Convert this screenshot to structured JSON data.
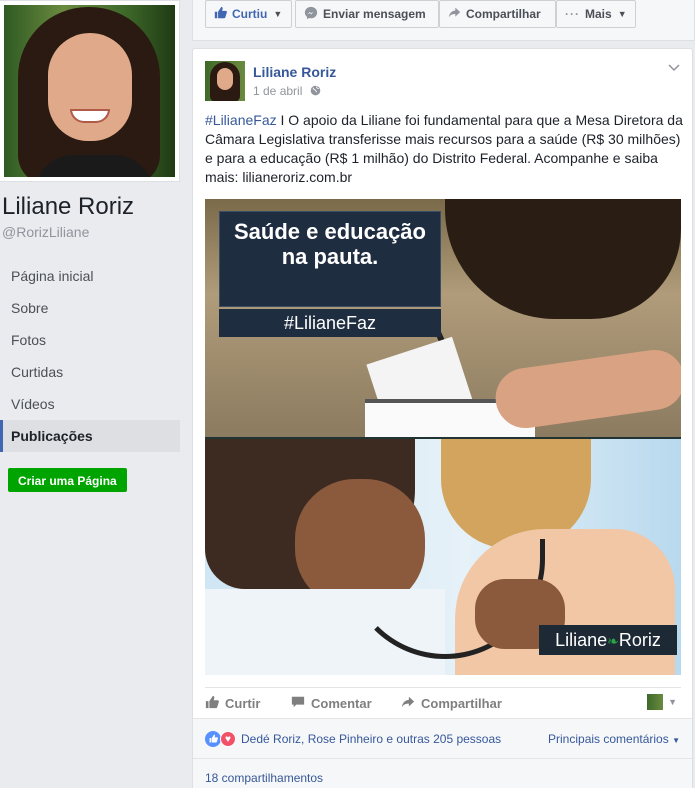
{
  "profile": {
    "name": "Liliane Roriz",
    "handle": "@RorizLiliane"
  },
  "nav": {
    "items": [
      "Página inicial",
      "Sobre",
      "Fotos",
      "Curtidas",
      "Vídeos",
      "Publicações"
    ],
    "active": "Publicações",
    "create_page": "Criar uma Página"
  },
  "actionbar": {
    "like": "Curtiu",
    "message": "Enviar mensagem",
    "share": "Compartilhar",
    "more": "Mais"
  },
  "post": {
    "author": "Liliane Roriz",
    "date": "1 de abril",
    "privacy_icon": "globe-icon",
    "hashtag": "#LilianeFaz",
    "text": " I O apoio da Liliane foi fundamental para que a Mesa Diretora da Câmara Legislativa transferisse mais recursos para a saúde (R$ 30 milhões) e para a educação (R$ 1 milhão) do Distrito Federal. Acompanhe e saiba mais: lilianeroriz.com.br",
    "image": {
      "headline_line1": "Saúde e educação",
      "headline_line2": "na pauta.",
      "headline_tag": "#LilianeFaz",
      "brand_left": "Liliane",
      "brand_right": "Roriz"
    },
    "actions": {
      "like": "Curtir",
      "comment": "Comentar",
      "share": "Compartilhar"
    },
    "reactions_text": "Dedé Roriz, Rose Pinheiro e outras 205 pessoas",
    "sort_label": "Principais comentários",
    "shares": "18 compartilhamentos"
  },
  "colors": {
    "link": "#365899",
    "create_page_bg": "#00a400",
    "like_reaction": "#5890ff",
    "love_reaction": "#f25268"
  }
}
